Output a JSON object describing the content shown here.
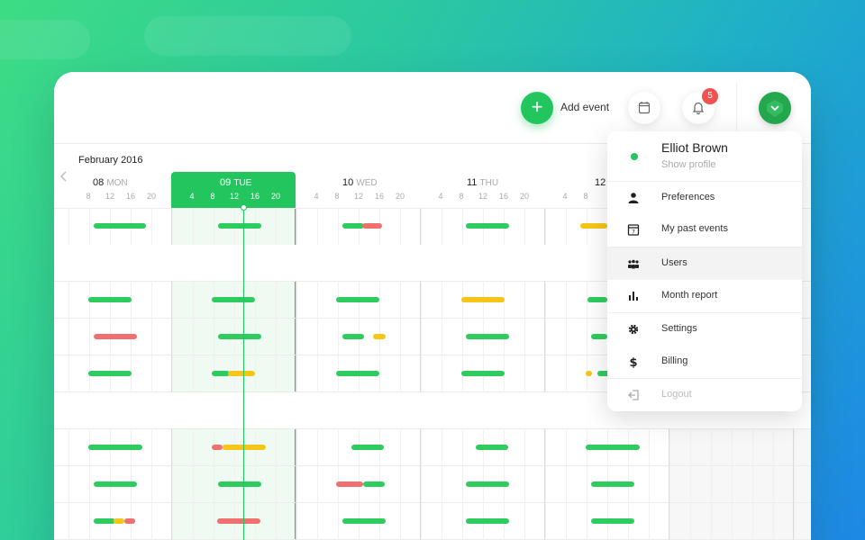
{
  "header": {
    "add_event_label": "Add event",
    "calendar_icon": "calendar-icon",
    "notification_icon": "bell-icon",
    "notification_count": "5",
    "avatar_icon": "chevron-down-icon"
  },
  "calendar": {
    "month_label": "February 2016",
    "days": [
      {
        "num": "08",
        "name": "MON",
        "ticks": [
          "8",
          "12",
          "16",
          "20"
        ]
      },
      {
        "num": "09",
        "name": "TUE",
        "ticks": [
          "4",
          "8",
          "12",
          "16",
          "20"
        ],
        "active": true
      },
      {
        "num": "10",
        "name": "WED",
        "ticks": [
          "4",
          "8",
          "12",
          "16",
          "20"
        ]
      },
      {
        "num": "11",
        "name": "THU",
        "ticks": [
          "4",
          "8",
          "12",
          "16",
          "20"
        ]
      },
      {
        "num": "12",
        "name": "",
        "ticks": [
          "4",
          "8"
        ]
      }
    ],
    "colors": {
      "ok": "#2ecc5f",
      "warn": "#f5c518",
      "bad": "#f07070",
      "accent": "#22c55e"
    }
  },
  "menu": {
    "name": "Elliot Brown",
    "show_profile": "Show profile",
    "items": [
      {
        "label": "Preferences",
        "icon": "user-icon"
      },
      {
        "label": "My past events",
        "icon": "calendar-icon"
      },
      {
        "label": "Users",
        "icon": "users-icon"
      },
      {
        "label": "Month report",
        "icon": "bar-chart-icon"
      },
      {
        "label": "Settings",
        "icon": "gear-icon"
      },
      {
        "label": "Billing",
        "icon": "dollar-icon"
      },
      {
        "label": "Logout",
        "icon": "logout-icon"
      }
    ]
  }
}
